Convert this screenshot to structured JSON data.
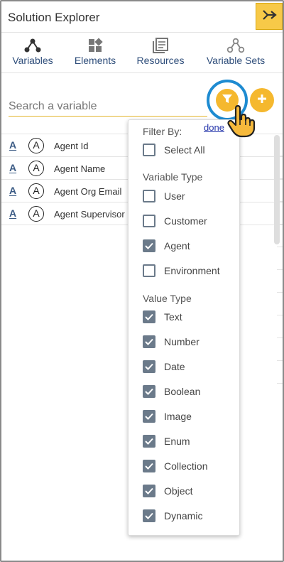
{
  "header": {
    "title": "Solution Explorer",
    "collapse_icon": "double-chevron-right-icon"
  },
  "tabs": [
    {
      "label": "Variables",
      "icon": "variables-icon"
    },
    {
      "label": "Elements",
      "icon": "elements-icon"
    },
    {
      "label": "Resources",
      "icon": "resources-icon"
    },
    {
      "label": "Variable Sets",
      "icon": "variable-sets-icon"
    }
  ],
  "search": {
    "placeholder": "Search a variable",
    "value": ""
  },
  "done_link": "done",
  "variables": [
    {
      "type_icon": "A",
      "agent_icon": "A",
      "name": "Agent Id"
    },
    {
      "type_icon": "A",
      "agent_icon": "A",
      "name": "Agent Name"
    },
    {
      "type_icon": "A",
      "agent_icon": "A",
      "name": "Agent Org Email"
    },
    {
      "type_icon": "A",
      "agent_icon": "A",
      "name": "Agent Supervisor"
    }
  ],
  "filter": {
    "filter_by_label": "Filter By:",
    "select_all": {
      "label": "Select All",
      "checked": false
    },
    "variable_type_label": "Variable Type",
    "variable_types": [
      {
        "label": "User",
        "checked": false
      },
      {
        "label": "Customer",
        "checked": false
      },
      {
        "label": "Agent",
        "checked": true
      },
      {
        "label": "Environment",
        "checked": false
      }
    ],
    "value_type_label": "Value Type",
    "value_types": [
      {
        "label": "Text",
        "checked": true
      },
      {
        "label": "Number",
        "checked": true
      },
      {
        "label": "Date",
        "checked": true
      },
      {
        "label": "Boolean",
        "checked": true
      },
      {
        "label": "Image",
        "checked": true
      },
      {
        "label": "Enum",
        "checked": true
      },
      {
        "label": "Collection",
        "checked": true
      },
      {
        "label": "Object",
        "checked": true
      },
      {
        "label": "Dynamic",
        "checked": true
      }
    ]
  },
  "colors": {
    "accent": "#f5b82e",
    "highlight_ring": "#1e8bd1",
    "checkbox": "#6b7a8a",
    "tab_text": "#2e4d7a"
  }
}
